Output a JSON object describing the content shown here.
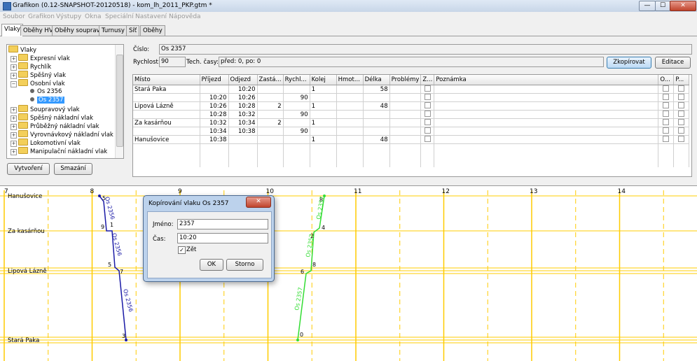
{
  "window": {
    "title": "Grafikon (0.12-SNAPSHOT-20120518) - kom_lh_2011_PKP.gtm *",
    "minimize": "—",
    "maximize": "☐",
    "close": "✕"
  },
  "menu": [
    "Soubor",
    "Grafikon",
    "Výstupy",
    "Okna",
    "Speciální",
    "Nastavení",
    "Nápověda"
  ],
  "tabs": [
    "Vlaky",
    "Oběhy HV",
    "Oběhy souprav",
    "Turnusy",
    "Síť",
    "Oběhy"
  ],
  "tree": {
    "root": "Vlaky",
    "items": [
      "Expresní vlak",
      "Rychlík",
      "Spěšný vlak",
      "Osobní vlak",
      "Os 2356",
      "Os 2357",
      "Soupravový vlak",
      "Spěšný nákladní vlak",
      "Průběžný nákladní vlak",
      "Vyrovnávkový nákladní vlak",
      "Lokomotivní vlak",
      "Manipulační nákladní vlak"
    ],
    "expand_plus": "+",
    "expand_minus": "−"
  },
  "buttons": {
    "create": "Vytvoření",
    "delete": "Smazání",
    "copy": "Zkopírovat",
    "edit": "Editace"
  },
  "train": {
    "number_label": "Číslo:",
    "number": "Os 2357",
    "speed_label": "Rychlost:",
    "speed": "90",
    "tech_label": "Tech. časy:",
    "tech": "před: 0, po: 0"
  },
  "table": {
    "headers": [
      "Místo",
      "Příjezd",
      "Odjezd",
      "Zastá...",
      "Rychl...",
      "Kolej",
      "Hmot...",
      "Délka",
      "Problémy",
      "Z...",
      "Poznámka",
      "O...",
      "P..."
    ],
    "rows": [
      [
        "Stará Paka",
        "",
        "10:20",
        "",
        "",
        "1",
        "",
        "58",
        "",
        "",
        "",
        "",
        ""
      ],
      [
        "",
        "10:20",
        "10:26",
        "",
        "90",
        "",
        "",
        "",
        "",
        "",
        "",
        "",
        ""
      ],
      [
        "Lipová Lázně",
        "10:26",
        "10:28",
        "2",
        "",
        "1",
        "",
        "48",
        "",
        "",
        "",
        "",
        ""
      ],
      [
        "",
        "10:28",
        "10:32",
        "",
        "90",
        "",
        "",
        "",
        "",
        "",
        "",
        "",
        ""
      ],
      [
        "Za kasárňou",
        "10:32",
        "10:34",
        "2",
        "",
        "1",
        "",
        "",
        "",
        "",
        "",
        "",
        ""
      ],
      [
        "",
        "10:34",
        "10:38",
        "",
        "90",
        "",
        "",
        "",
        "",
        "",
        "",
        "",
        ""
      ],
      [
        "Hanušovice",
        "10:38",
        "",
        "",
        "",
        "1",
        "",
        "48",
        "",
        "",
        "",
        "",
        ""
      ]
    ]
  },
  "graph": {
    "hours": [
      "7",
      "8",
      "9",
      "10",
      "11",
      "12",
      "13",
      "14"
    ],
    "stations": [
      "Hanušovice",
      "Za kasárňou",
      "Lipová Lázně",
      "Stará Paka"
    ],
    "trains": [
      {
        "name": "Os 2356",
        "color": "#1a1aa6",
        "minute_labels": [
          "5",
          "9",
          "1",
          "5",
          "7",
          "3"
        ]
      },
      {
        "name": "Os 2357",
        "color": "#33dd33",
        "minute_labels": [
          "0",
          "6",
          "8",
          "2",
          "4",
          "8"
        ]
      }
    ],
    "grid_color": "#ffcc00"
  },
  "dialog": {
    "title": "Kopírování vlaku Os 2357",
    "name_label": "Jméno:",
    "name_value": "2357",
    "time_label": "Čas:",
    "time_value": "10:20",
    "checkbox_label": "Zět",
    "checked": "✓",
    "ok": "OK",
    "cancel": "Storno",
    "close": "✕"
  }
}
